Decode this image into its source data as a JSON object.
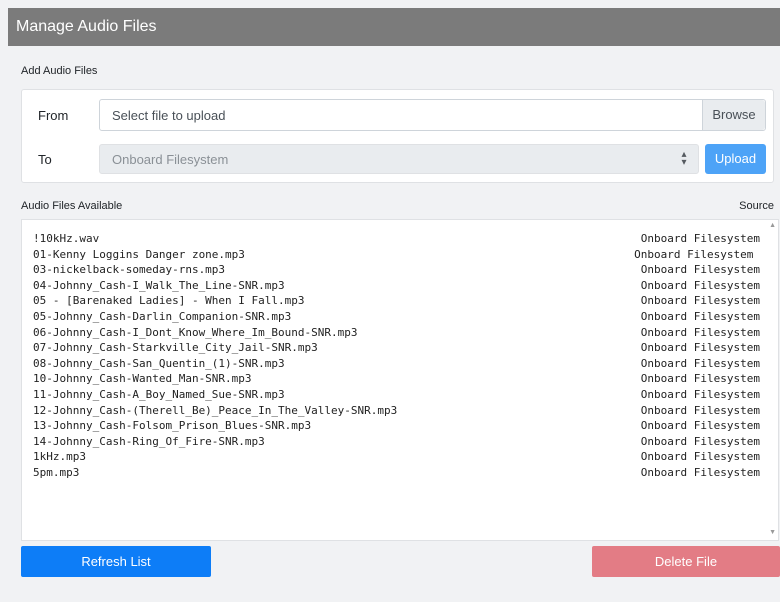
{
  "window": {
    "title": "Manage Audio Files"
  },
  "add_section": {
    "label": "Add Audio Files",
    "from_label": "From",
    "file_placeholder": "Select file to upload",
    "browse_label": "Browse",
    "to_label": "To",
    "target_value": "Onboard Filesystem",
    "upload_label": "Upload"
  },
  "list_section": {
    "label": "Audio Files Available",
    "source_header": "Source",
    "files": [
      {
        "name": "!10kHz.wav",
        "source": "Onboard Filesystem"
      },
      {
        "name": "01-Kenny Loggins Danger zone.mp3",
        "source": "Onboard Filesystem "
      },
      {
        "name": "03-nickelback-someday-rns.mp3",
        "source": "Onboard Filesystem"
      },
      {
        "name": "04-Johnny_Cash-I_Walk_The_Line-SNR.mp3",
        "source": "Onboard Filesystem"
      },
      {
        "name": "05 - [Barenaked Ladies] - When I Fall.mp3",
        "source": "Onboard Filesystem"
      },
      {
        "name": "05-Johnny_Cash-Darlin_Companion-SNR.mp3",
        "source": "Onboard Filesystem"
      },
      {
        "name": "06-Johnny_Cash-I_Dont_Know_Where_Im_Bound-SNR.mp3",
        "source": "Onboard Filesystem"
      },
      {
        "name": "07-Johnny_Cash-Starkville_City_Jail-SNR.mp3",
        "source": "Onboard Filesystem"
      },
      {
        "name": "08-Johnny_Cash-San_Quentin_(1)-SNR.mp3",
        "source": "Onboard Filesystem"
      },
      {
        "name": "10-Johnny_Cash-Wanted_Man-SNR.mp3",
        "source": "Onboard Filesystem"
      },
      {
        "name": "11-Johnny_Cash-A_Boy_Named_Sue-SNR.mp3",
        "source": "Onboard Filesystem"
      },
      {
        "name": "12-Johnny_Cash-(Therell_Be)_Peace_In_The_Valley-SNR.mp3",
        "source": "Onboard Filesystem"
      },
      {
        "name": "13-Johnny_Cash-Folsom_Prison_Blues-SNR.mp3",
        "source": "Onboard Filesystem"
      },
      {
        "name": "14-Johnny_Cash-Ring_Of_Fire-SNR.mp3",
        "source": "Onboard Filesystem"
      },
      {
        "name": "1kHz.mp3",
        "source": "Onboard Filesystem"
      },
      {
        "name": "5pm.mp3",
        "source": "Onboard Filesystem"
      }
    ]
  },
  "actions": {
    "refresh_label": "Refresh List",
    "delete_label": "Delete File"
  },
  "icons": {
    "select_arrows": "select-arrows-icon",
    "scroll_up": "scroll-up-icon",
    "scroll_down": "scroll-down-icon"
  },
  "colors": {
    "titlebar": "#7b7b7b",
    "primary": "#0d7df7",
    "upload": "#4da3f7",
    "danger": "#e37c85"
  }
}
